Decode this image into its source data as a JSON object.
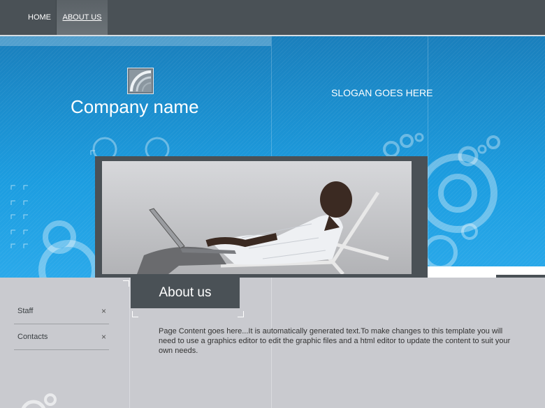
{
  "nav": {
    "items": [
      {
        "label": "HOME"
      },
      {
        "label": "ABOUT US"
      }
    ]
  },
  "header": {
    "company_name": "Company name",
    "slogan": "SLOGAN GOES HERE"
  },
  "sidebar": {
    "items": [
      {
        "label": "Staff",
        "close": "×"
      },
      {
        "label": "Contacts",
        "close": "×"
      }
    ]
  },
  "main": {
    "heading": "About us",
    "body": "Page Content goes here...It is automatically generated text.To make changes to this template you will need to use a graphics editor to edit the graphic files and a html editor to update the content to suit your own needs."
  },
  "colors": {
    "nav_bg": "#4a5156",
    "header_blue": "#1c9de0",
    "content_bg": "#c9cacf"
  }
}
